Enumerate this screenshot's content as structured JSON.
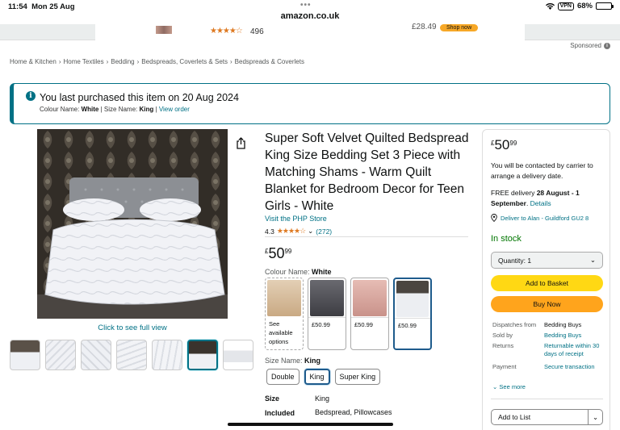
{
  "status": {
    "time": "11:54",
    "date": "Mon 25 Aug",
    "vpn": "VPN",
    "battery": "68%"
  },
  "browser": {
    "url": "amazon.co.uk"
  },
  "ad": {
    "review_count": "496",
    "price": "£28.49",
    "shop_label": "Shop now"
  },
  "sponsored_label": "Sponsored",
  "breadcrumb": [
    "Home & Kitchen",
    "Home Textiles",
    "Bedding",
    "Bedspreads, Coverlets & Sets",
    "Bedspreads & Coverlets"
  ],
  "notice": {
    "title": "You last purchased this item on 20 Aug 2024",
    "colour_key": "Colour Name:",
    "colour_val": "White",
    "size_key": "Size Name:",
    "size_val": "King",
    "view_order": "View order"
  },
  "gallery": {
    "click_full": "Click to see full view",
    "thumb_count": 7,
    "selected_thumb": 6
  },
  "product": {
    "title": "Super Soft Velvet Quilted Bedspread King Size Bedding Set 3 Piece with Matching Shams - Warm Quilt Blanket for Bedroom Decor for Teen Girls - White",
    "store": "Visit the PHP Store",
    "rating": "4.3",
    "rating_count": "(272)",
    "price_symbol": "£",
    "price_whole": "50",
    "price_fraction": "99",
    "colour_label": "Colour Name:",
    "colour_value": "White",
    "colour_options": [
      {
        "label": "See available options",
        "color": "#d9c2a6"
      },
      {
        "label": "£50.99",
        "color": "#4a4a4e"
      },
      {
        "label": "£50.99",
        "color": "#d9a9a0"
      },
      {
        "label": "£50.99",
        "color": "#e8eaee"
      }
    ],
    "size_label": "Size Name:",
    "size_value": "King",
    "sizes": [
      "Double",
      "King",
      "Super King"
    ],
    "specs": [
      {
        "key": "Size",
        "value": "King"
      },
      {
        "key": "Included components",
        "value": "Bedspread, Pillowcases"
      }
    ]
  },
  "buybox": {
    "price_symbol": "£",
    "price_whole": "50",
    "price_fraction": "99",
    "contact": "You will be contacted by carrier to arrange a delivery date.",
    "delivery_prefix": "FREE delivery ",
    "delivery_date": "28 August - 1 September",
    "delivery_link": "Details",
    "location": "Deliver to Alan - Guildford GU2 8",
    "stock": "In stock",
    "quantity": "Quantity:  1",
    "add_to_basket": "Add to Basket",
    "buy_now": "Buy Now",
    "rows": [
      {
        "key": "Dispatches from",
        "value": "Bedding Buys"
      },
      {
        "key": "Sold by",
        "value": "Bedding Buys"
      },
      {
        "key": "Returns",
        "value": "Returnable within 30 days of receipt"
      },
      {
        "key": "Payment",
        "value": "Secure transaction"
      }
    ],
    "see_more": "See more",
    "add_to_list": "Add to List"
  }
}
